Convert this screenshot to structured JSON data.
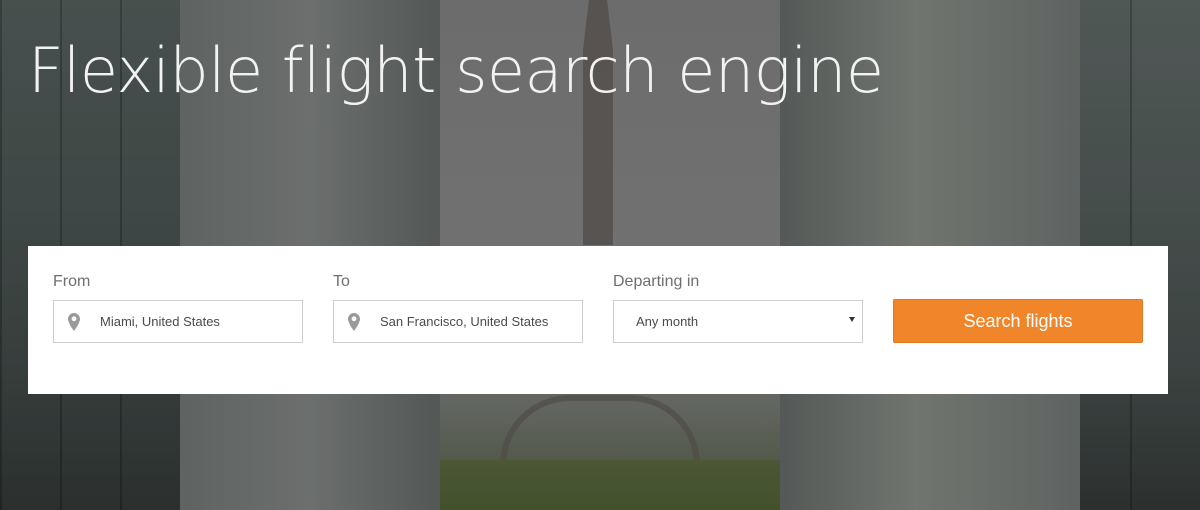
{
  "hero": {
    "headline": "Flexible flight search engine"
  },
  "search": {
    "from": {
      "label": "From",
      "value": "Miami, United States",
      "icon": "map-pin-icon"
    },
    "to": {
      "label": "To",
      "value": "San Francisco, United States",
      "icon": "map-pin-icon"
    },
    "departing": {
      "label": "Departing in",
      "selected": "Any month",
      "icon": "caret-down-icon"
    },
    "submit_label": "Search flights"
  },
  "colors": {
    "accent": "#f0852a",
    "panel_bg": "#ffffff",
    "headline_text": "#f2f2f2"
  }
}
